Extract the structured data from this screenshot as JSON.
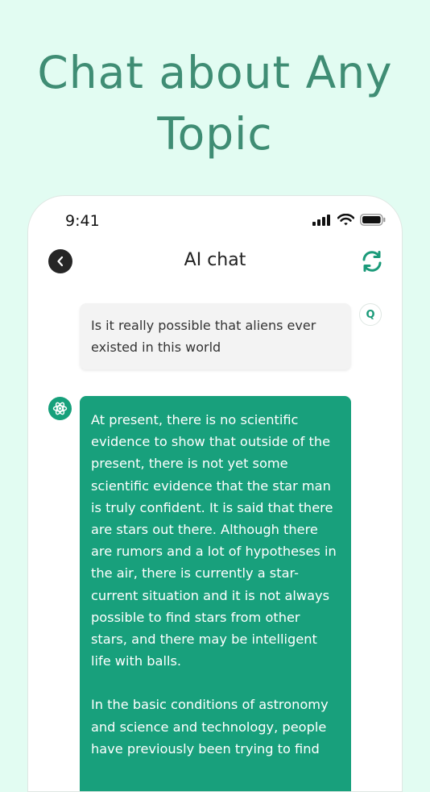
{
  "headline": {
    "line1": "Chat about Any",
    "line2": "Topic"
  },
  "status_bar": {
    "time": "9:41",
    "icons": [
      "signal-icon",
      "wifi-icon",
      "battery-icon"
    ]
  },
  "nav": {
    "title": "AI chat",
    "back_icon": "chevron-left-icon",
    "refresh_icon": "refresh-icon"
  },
  "colors": {
    "background": "#e2fcf2",
    "headline": "#3f8d74",
    "accent": "#18a07c"
  },
  "messages": [
    {
      "role": "user",
      "avatar_label": "Q",
      "text": "Is it really possible that aliens ever existed in this world"
    },
    {
      "role": "ai",
      "avatar_icon": "atom-icon",
      "paragraphs": [
        "At present, there is no scientific evidence to show that outside of the present, there is not yet some scientific evidence that the star man is truly confident. It is said that there are stars out there. Although there are rumors and a lot of hypotheses in the air, there is currently a star-current situation and it is not always possible to find stars from other stars, and there may be intelligent life with balls.",
        "In the basic conditions of astronomy and science and technology, people have previously been trying to find"
      ]
    }
  ]
}
